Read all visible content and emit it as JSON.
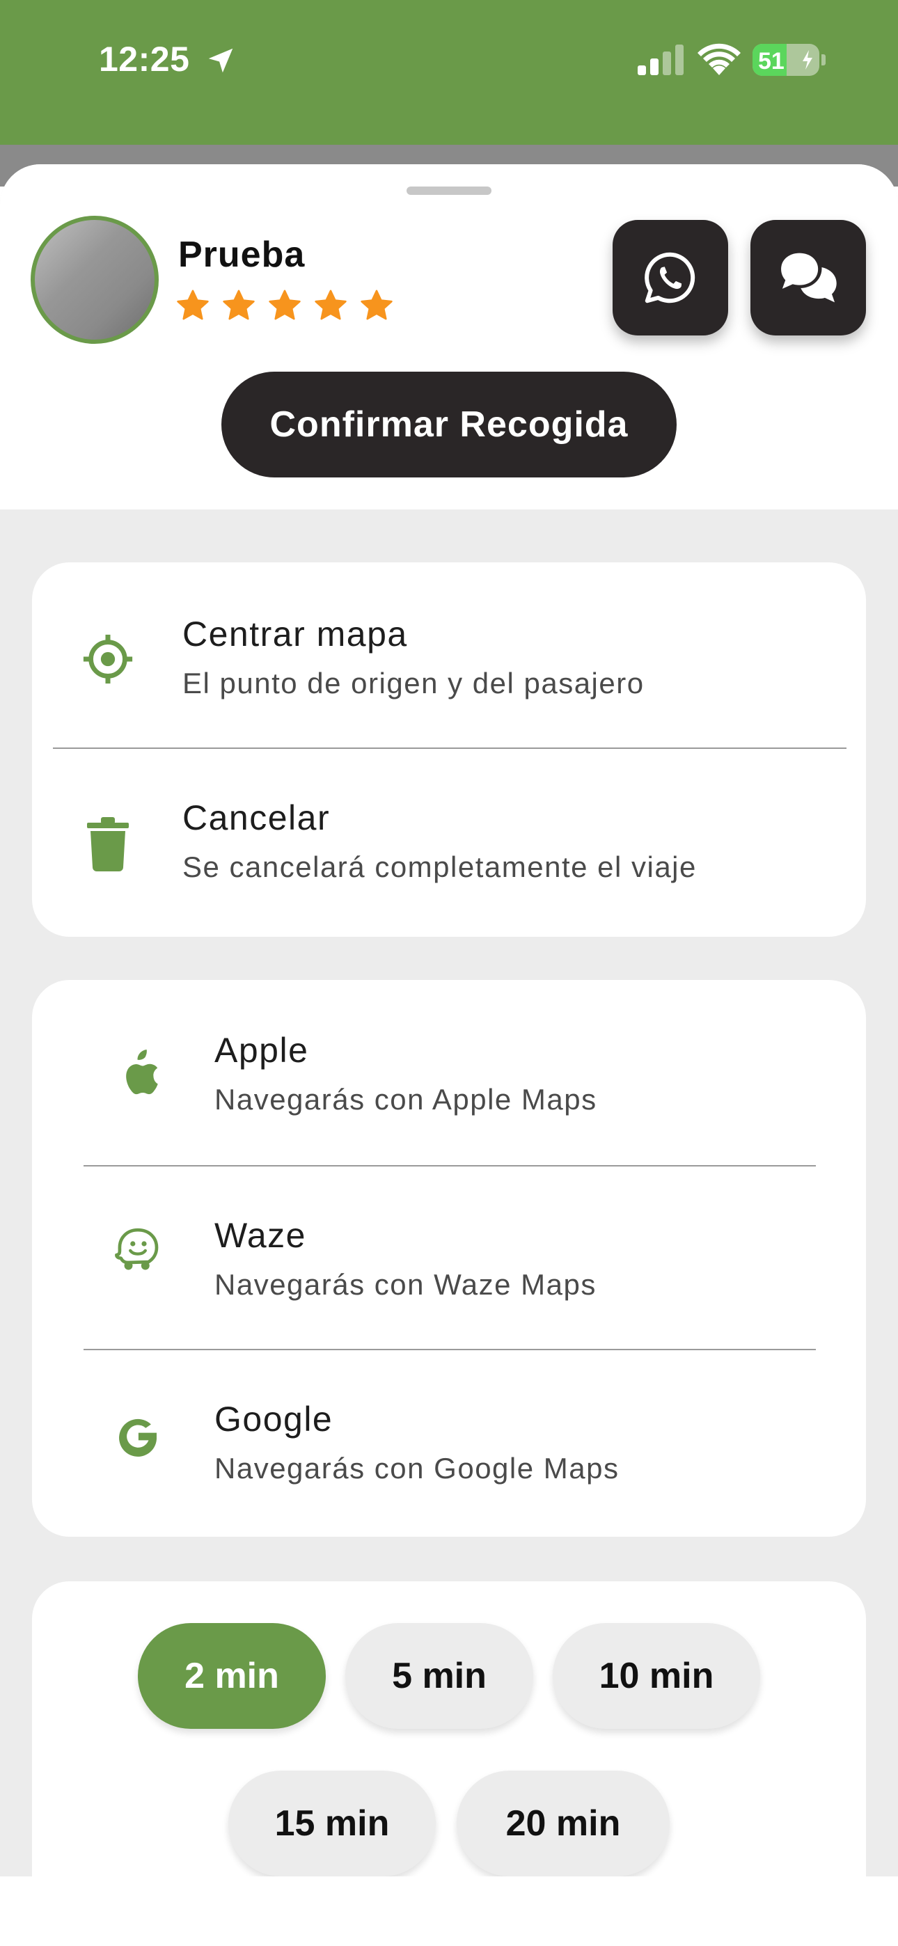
{
  "status_bar": {
    "time": "12:25",
    "battery_level": "51",
    "battery_fraction": 0.51
  },
  "driver": {
    "name": "Prueba",
    "rating": 5
  },
  "actions": {
    "confirm_label": "Confirmar Recogida"
  },
  "trip_options": [
    {
      "title": "Centrar mapa",
      "subtitle": "El punto de origen y del pasajero",
      "icon": "crosshair-icon"
    },
    {
      "title": "Cancelar",
      "subtitle": "Se cancelará completamente el viaje",
      "icon": "trash-icon"
    }
  ],
  "navigation": [
    {
      "title": "Apple",
      "subtitle": "Navegarás con Apple Maps",
      "icon": "apple-icon"
    },
    {
      "title": "Waze",
      "subtitle": "Navegarás con Waze Maps",
      "icon": "waze-icon"
    },
    {
      "title": "Google",
      "subtitle": "Navegarás con Google Maps",
      "icon": "google-icon"
    }
  ],
  "time_options": [
    {
      "label": "2 min",
      "selected": true
    },
    {
      "label": "5 min",
      "selected": false
    },
    {
      "label": "10 min",
      "selected": false
    },
    {
      "label": "15 min",
      "selected": false
    },
    {
      "label": "20 min",
      "selected": false
    }
  ],
  "colors": {
    "accent": "#6a9a49",
    "dark": "#2a2627",
    "star": "#f7941d",
    "sheet_bg": "#ececec"
  }
}
